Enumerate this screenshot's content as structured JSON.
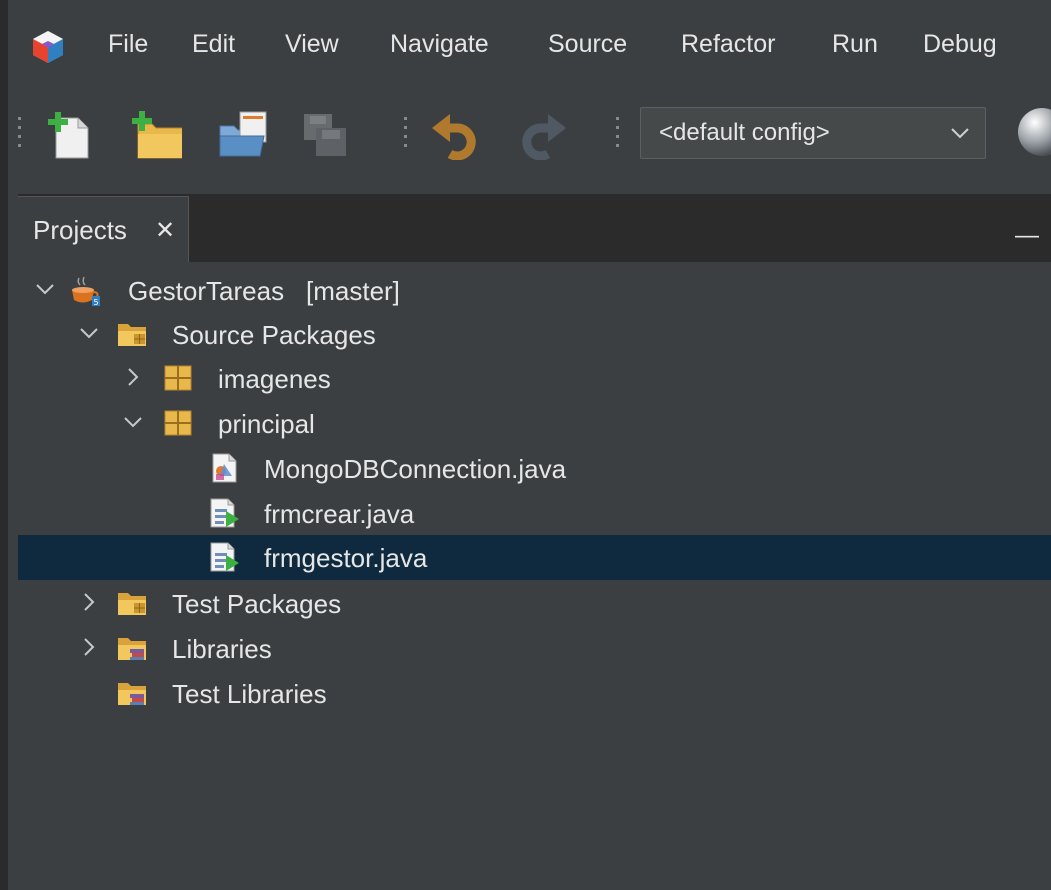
{
  "menubar": {
    "app_icon": "netbeans-cube-icon",
    "items": [
      "File",
      "Edit",
      "View",
      "Navigate",
      "Source",
      "Refactor",
      "Run",
      "Debug"
    ]
  },
  "toolbar": {
    "buttons": [
      {
        "name": "new-file",
        "icon": "new-file-icon",
        "enabled": true
      },
      {
        "name": "new-project",
        "icon": "new-project-icon",
        "enabled": true
      },
      {
        "name": "open-project",
        "icon": "open-project-icon",
        "enabled": true
      },
      {
        "name": "save-all",
        "icon": "save-all-icon",
        "enabled": false
      },
      {
        "name": "undo",
        "icon": "undo-icon",
        "enabled": true
      },
      {
        "name": "redo",
        "icon": "redo-icon",
        "enabled": false
      }
    ],
    "config_select": {
      "value": "<default config>"
    },
    "build_icon": "globe-icon"
  },
  "panel": {
    "tab_label": "Projects",
    "close_symbol": "✕",
    "minimize_symbol": "—"
  },
  "tree": {
    "project": {
      "name": "GestorTareas",
      "branch": "[master]",
      "expanded": true
    },
    "source_packages": {
      "label": "Source Packages",
      "expanded": true
    },
    "packages": [
      {
        "label": "imagenes",
        "expanded": false
      },
      {
        "label": "principal",
        "expanded": true
      }
    ],
    "files": [
      {
        "label": "MongoDBConnection.java",
        "icon": "java-class-icon",
        "selected": false
      },
      {
        "label": "frmcrear.java",
        "icon": "java-form-icon",
        "selected": false
      },
      {
        "label": "frmgestor.java",
        "icon": "java-form-icon",
        "selected": true
      }
    ],
    "test_packages": {
      "label": "Test Packages",
      "expanded": false
    },
    "libraries": {
      "label": "Libraries",
      "expanded": false
    },
    "test_libraries": {
      "label": "Test Libraries"
    }
  },
  "colors": {
    "background": "#3b3f42",
    "selection": "#0f2a3e",
    "text": "#e6e6e6",
    "folder": "#e8b84b",
    "green_plus": "#3cb043"
  }
}
